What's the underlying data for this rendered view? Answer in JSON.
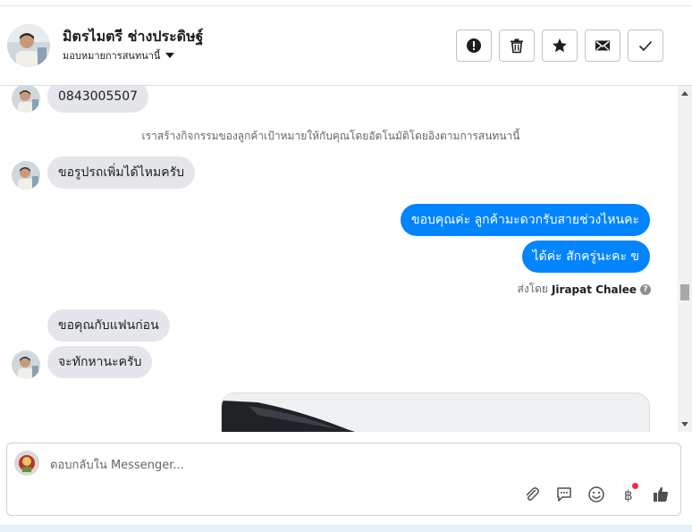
{
  "header": {
    "contact_name": "มิตรไมตรี ช่างประดิษฐ์",
    "assign_label": "มอบหมายการสนทนานี้",
    "actions": [
      {
        "name": "mark-spam-button",
        "icon": "alert-circle-icon"
      },
      {
        "name": "delete-button",
        "icon": "trash-icon"
      },
      {
        "name": "star-button",
        "icon": "star-icon"
      },
      {
        "name": "mark-unread-button",
        "icon": "envelope-icon"
      },
      {
        "name": "mark-done-button",
        "icon": "checkmark-icon"
      }
    ]
  },
  "messages": {
    "incoming_phone": "0843005507",
    "system_note": "เราสร้างกิจกรรมของลูกค้าเป้าหมายให้กับคุณโดยอัตโนมัติโดยอิงตามการสนทนานี้",
    "incoming_request": "ขอรูปรถเพิ่มได้ไหมครับ",
    "outgoing_1": "ขอบคุณค่ะ ลูกค้ามะดวกรับสายช่วงไหนคะ",
    "outgoing_2": "ได้ค่ะ สักครู่นะคะ ข",
    "sent_by_label": "ส่งโดย",
    "sent_by_name": "Jirapat Chalee",
    "incoming_thanks": "ขอคุณกับแฟนก่อน",
    "incoming_call": "จะทักหานะครับ"
  },
  "composer": {
    "placeholder": "ตอบกลับใน Messenger...",
    "icons": [
      "paperclip-icon",
      "saved-reply-icon",
      "emoji-icon",
      "baht-payment-icon",
      "thumbs-up-icon"
    ]
  },
  "colors": {
    "outgoing_bubble": "#0084ff",
    "incoming_bubble": "#e4e6eb",
    "notification_dot": "#f02849"
  }
}
